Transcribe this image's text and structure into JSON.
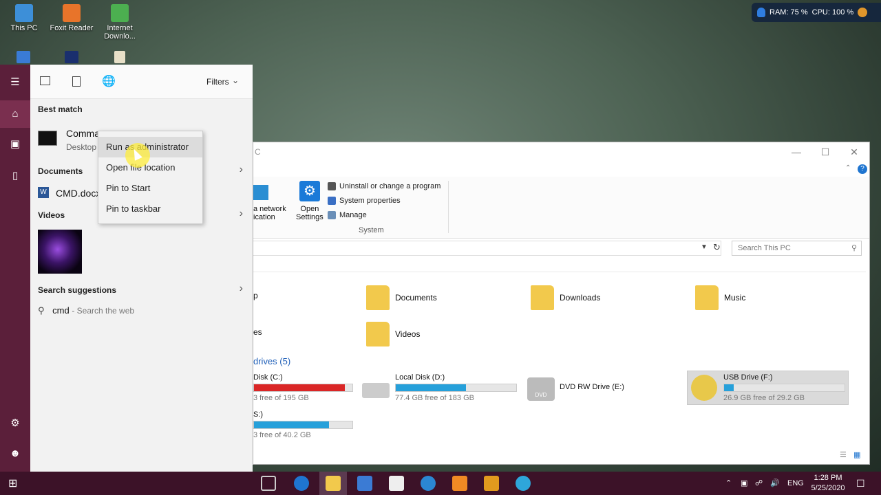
{
  "desktop": {
    "icons": [
      {
        "label": "This PC"
      },
      {
        "label": "Foxit Reader"
      },
      {
        "label": "Internet Downlo..."
      }
    ],
    "sysmon": {
      "ram": "RAM: 75 %",
      "cpu": "CPU: 100 %"
    }
  },
  "explorer": {
    "title_fragment": "C",
    "ribbon": {
      "network_label": "a network\nication",
      "open_settings": "Open\nSettings",
      "uninstall": "Uninstall or change a program",
      "system_properties": "System properties",
      "manage": "Manage",
      "group_label": "System"
    },
    "search_placeholder": "Search This PC",
    "folders": [
      "p",
      "Documents",
      "Downloads",
      "Music",
      "es",
      "Videos"
    ],
    "drives_header": "drives (5)",
    "drives": [
      {
        "name": "Disk (C:)",
        "free": "3 free of 195 GB",
        "used_fraction": 0.92,
        "color": "#da2626"
      },
      {
        "name": "Local Disk (D:)",
        "free": "77.4 GB free of 183 GB",
        "used_fraction": 0.58,
        "color": "#26a0da"
      },
      {
        "name": "DVD RW Drive (E:)"
      },
      {
        "name": "USB Drive (F:)",
        "free": "26.9 GB free of 29.2 GB",
        "used_fraction": 0.08,
        "color": "#26a0da"
      },
      {
        "name": "S:)",
        "free": "3 free of 40.2 GB",
        "used_fraction": 0.76,
        "color": "#26a0da"
      }
    ]
  },
  "start": {
    "filters": "Filters",
    "best_match": "Best match",
    "command_name": "Comma",
    "command_sub": "Desktop",
    "documents": "Documents",
    "doc_item": "CMD.docx",
    "videos": "Videos",
    "search_suggestions": "Search suggestions",
    "suggestion_text": "cmd",
    "suggestion_sub": "- Search the web",
    "search_value": "cmd"
  },
  "context_menu": {
    "items": [
      "Run as administrator",
      "Open file location",
      "Pin to Start",
      "Pin to taskbar"
    ]
  },
  "taskbar": {
    "lang": "ENG",
    "time": "1:28 PM",
    "date": "5/25/2020"
  }
}
